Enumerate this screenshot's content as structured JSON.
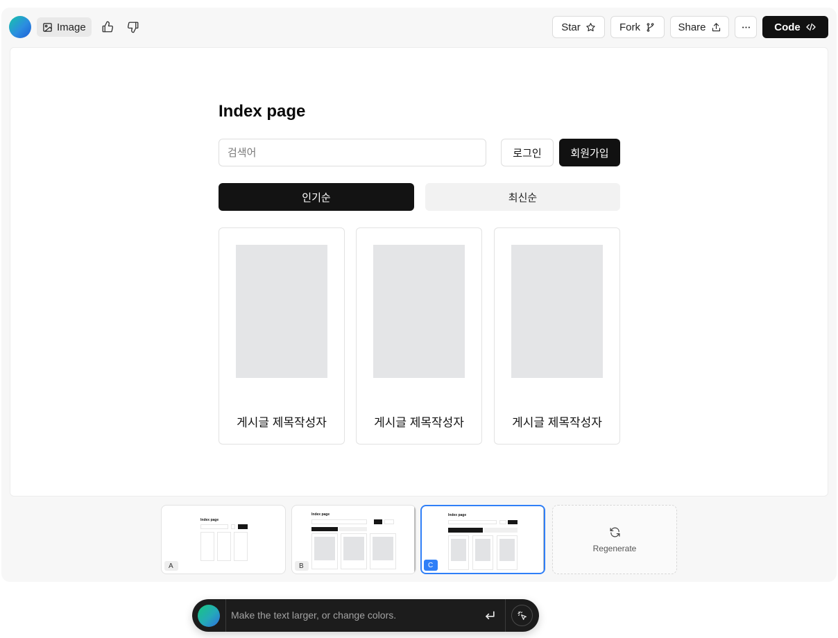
{
  "toolbar": {
    "image_label": "Image",
    "star_label": "Star",
    "fork_label": "Fork",
    "share_label": "Share",
    "code_label": "Code"
  },
  "preview": {
    "title": "Index page",
    "search_placeholder": "검색어",
    "login_label": "로그인",
    "signup_label": "회원가입",
    "tabs": [
      {
        "label": "인기순",
        "active": true
      },
      {
        "label": "최신순",
        "active": false
      }
    ],
    "cards": [
      {
        "caption": "게시글 제목작성자"
      },
      {
        "caption": "게시글 제목작성자"
      },
      {
        "caption": "게시글 제목작성자"
      }
    ]
  },
  "variants": [
    {
      "badge": "A",
      "selected": false
    },
    {
      "badge": "B",
      "selected": false
    },
    {
      "badge": "C",
      "selected": true
    }
  ],
  "regenerate_label": "Regenerate",
  "prompt": {
    "placeholder": "Make the text larger, or change colors."
  },
  "colors": {
    "accent_blue": "#2f7ff7",
    "dark": "#111111",
    "thumb_gray": "#e4e5e7"
  }
}
